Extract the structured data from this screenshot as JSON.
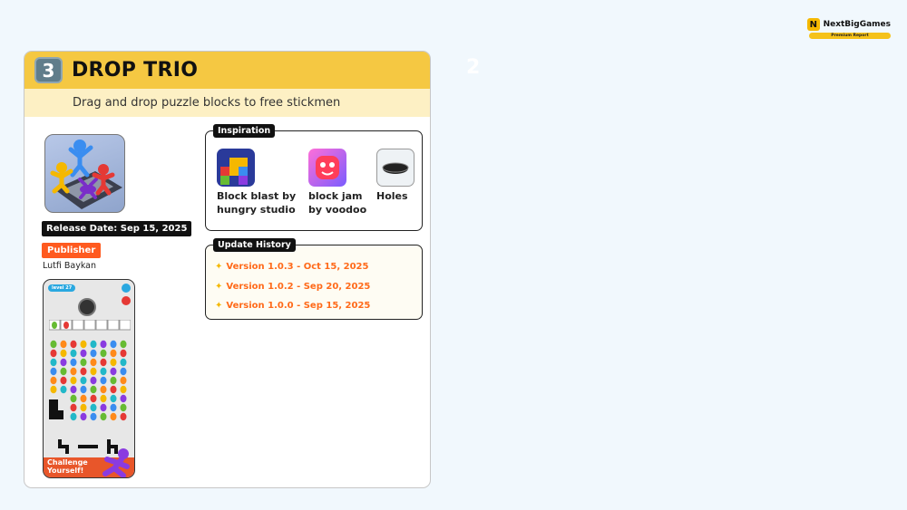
{
  "brand": {
    "name": "NextBigGames",
    "logo_letter": "N",
    "badge": "Premium Report"
  },
  "page_number": "2",
  "game": {
    "number": "3",
    "title": "DROP TRIO",
    "subtitle": "Drag and drop puzzle blocks to free stickmen",
    "release_date": "Release Date: Sep 15, 2025",
    "publisher_label": "Publisher",
    "publisher_name": "Lutfi Baykan"
  },
  "screenshot": {
    "level": "level 27",
    "banner_line1": "Challenge",
    "banner_line2": "Yourself!"
  },
  "inspiration": {
    "label": "Inspiration",
    "items": [
      {
        "line1": "Block blast by",
        "line2": "hungry studio",
        "icon": "block-blast-icon"
      },
      {
        "line1": "block jam",
        "line2": "by voodoo",
        "icon": "block-jam-icon"
      },
      {
        "line1": "Holes",
        "line2": "",
        "icon": "holes-icon"
      }
    ]
  },
  "update_history": {
    "label": "Update History",
    "items": [
      "Version 1.0.3 - Oct 15, 2025",
      "Version 1.0.2 - Sep 20, 2025",
      "Version 1.0.0 - Sep 15, 2025"
    ]
  },
  "colors": {
    "accent": "#f5c842",
    "publisher": "#ff5a1f",
    "update_text": "#ff6a1a"
  }
}
